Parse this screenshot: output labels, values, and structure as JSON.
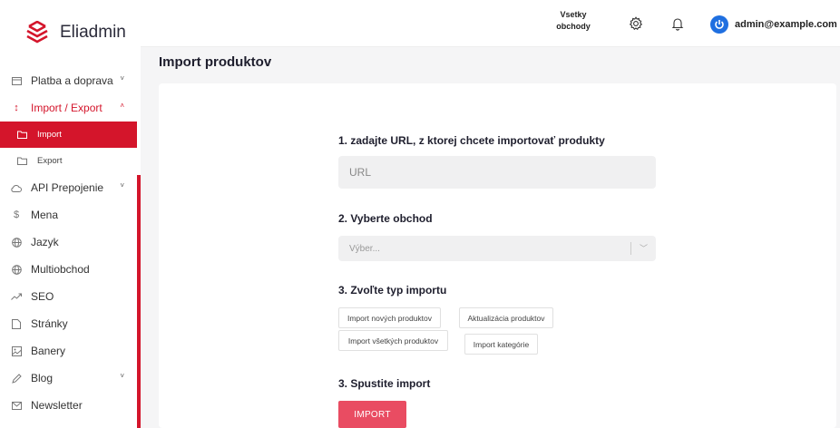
{
  "brand": {
    "name": "Eliadmin",
    "color": "#d4152b"
  },
  "topbar": {
    "store_switch_label": "Vsetky obchody",
    "settings_icon": "gear-icon",
    "notifications_icon": "bell-icon",
    "user_email": "admin@example.com"
  },
  "sidebar": {
    "items": [
      {
        "label": "Platba a doprava",
        "icon": "card-icon",
        "caret": "˅"
      },
      {
        "label": "Import / Export",
        "icon": "sort-arrows-icon",
        "caret": "˄",
        "open": true,
        "children": [
          {
            "label": "Import",
            "icon": "folder-icon",
            "active": true
          },
          {
            "label": "Export",
            "icon": "folder-icon"
          }
        ]
      },
      {
        "label": "API Prepojenie",
        "icon": "cloud-icon",
        "caret": "˅"
      },
      {
        "label": "Mena",
        "icon": "dollar-icon"
      },
      {
        "label": "Jazyk",
        "icon": "globe-icon"
      },
      {
        "label": "Multiobchod",
        "icon": "globe-icon"
      },
      {
        "label": "SEO",
        "icon": "trend-icon"
      },
      {
        "label": "Stránky",
        "icon": "page-icon"
      },
      {
        "label": "Banery",
        "icon": "image-icon"
      },
      {
        "label": "Blog",
        "icon": "pen-icon",
        "caret": "˅"
      },
      {
        "label": "Newsletter",
        "icon": "mail-icon"
      }
    ]
  },
  "main": {
    "title": "Import produktov",
    "step1": {
      "title": "1. zadajte URL, z ktorej chcete importovať produkty",
      "placeholder": "URL"
    },
    "step2": {
      "title": "2. Vyberte obchod",
      "placeholder": "Výber..."
    },
    "step3": {
      "title": "3. Zvoľte typ importu",
      "options": [
        "Import nových produktov",
        "Aktualizácia produktov",
        "Import všetkých produktov",
        "Import kategórie"
      ]
    },
    "step4": {
      "title": "3. Spustite import",
      "button": "IMPORT",
      "button_color": "#e94c62"
    }
  }
}
